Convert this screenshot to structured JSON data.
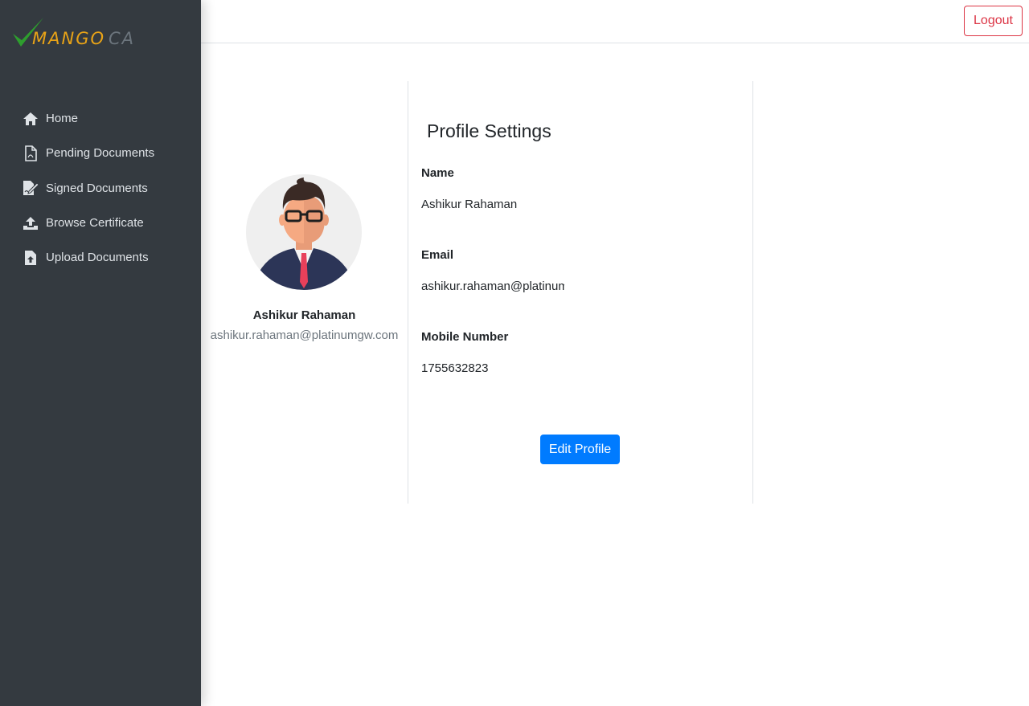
{
  "brand": {
    "logo_word": "MANGO",
    "logo_suffix": "CA"
  },
  "sidebar": {
    "items": [
      {
        "label": "Home",
        "icon": "home-icon"
      },
      {
        "label": "Pending Documents",
        "icon": "pdf-file-icon"
      },
      {
        "label": "Signed Documents",
        "icon": "signed-file-icon"
      },
      {
        "label": "Browse Certificate",
        "icon": "upload-tray-icon"
      },
      {
        "label": "Upload Documents",
        "icon": "file-upload-icon"
      }
    ]
  },
  "header": {
    "logout_label": "Logout"
  },
  "profile": {
    "name": "Ashikur Rahaman",
    "email": "ashikur.rahaman@platinumgw.com"
  },
  "settings": {
    "title": "Profile Settings",
    "fields": [
      {
        "label": "Name",
        "value": "Ashikur Rahaman"
      },
      {
        "label": "Email",
        "value": "ashikur.rahaman@platinumgw.com"
      },
      {
        "label": "Mobile Number",
        "value": "1755632823"
      }
    ],
    "edit_label": "Edit Profile"
  },
  "colors": {
    "sidebar_bg": "#343a40",
    "primary": "#007bff",
    "danger": "#dc3545",
    "logo_orange": "#e8a317",
    "logo_green": "#2e9e2e"
  }
}
